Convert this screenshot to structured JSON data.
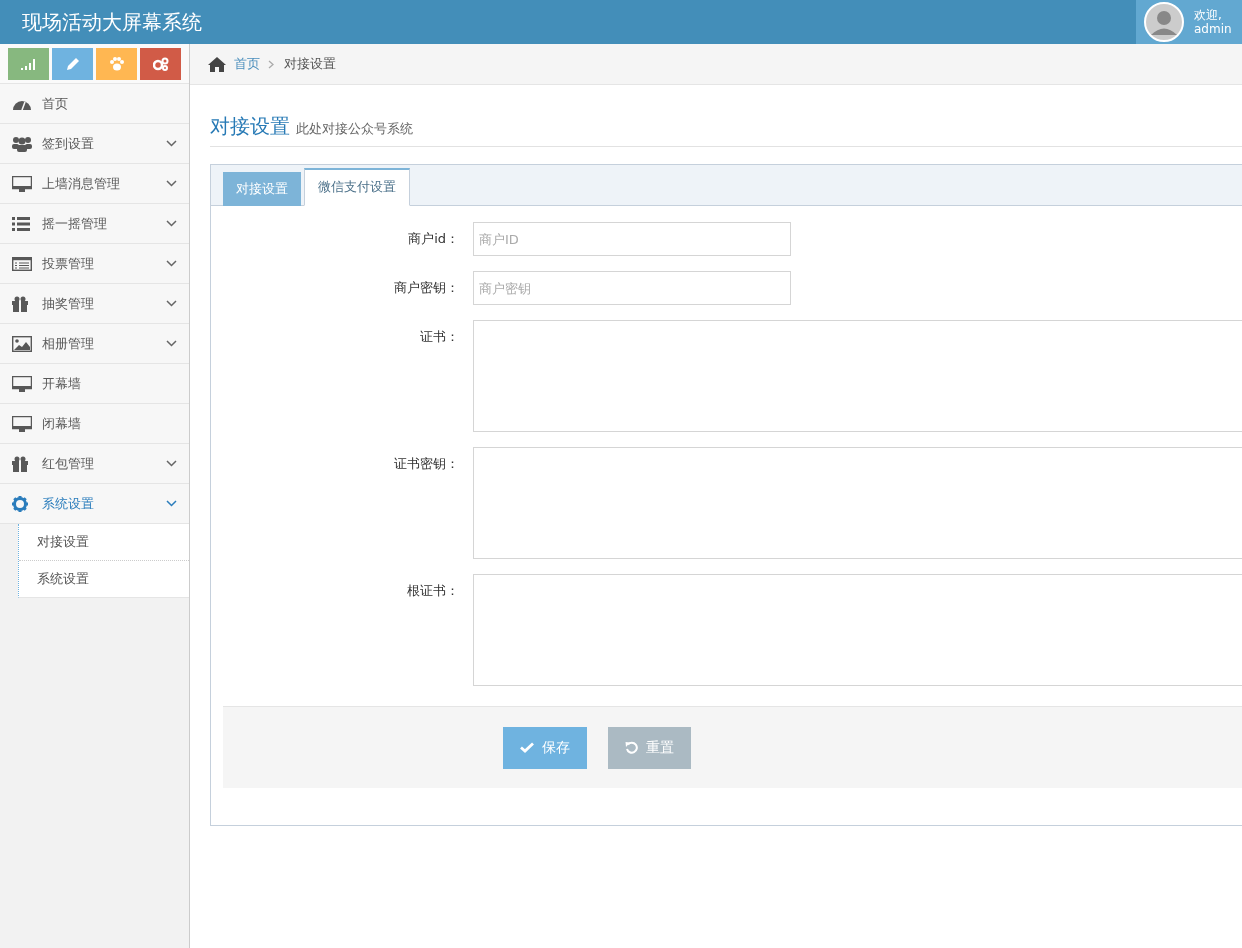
{
  "header": {
    "title": "现场活动大屏幕系统",
    "welcome": "欢迎,",
    "user": "admin"
  },
  "sidebar": {
    "shortcuts": [
      {
        "color": "#87b87f"
      },
      {
        "color": "#6fb3e0"
      },
      {
        "color": "#ffb752"
      },
      {
        "color": "#d15b47"
      }
    ],
    "items": [
      {
        "label": "首页",
        "has_submenu": false,
        "selected": false
      },
      {
        "label": "签到设置",
        "has_submenu": true,
        "selected": false
      },
      {
        "label": "上墙消息管理",
        "has_submenu": true,
        "selected": false
      },
      {
        "label": "摇一摇管理",
        "has_submenu": true,
        "selected": false
      },
      {
        "label": "投票管理",
        "has_submenu": true,
        "selected": false
      },
      {
        "label": "抽奖管理",
        "has_submenu": true,
        "selected": false
      },
      {
        "label": "相册管理",
        "has_submenu": true,
        "selected": false
      },
      {
        "label": "开幕墙",
        "has_submenu": false,
        "selected": false
      },
      {
        "label": "闭幕墙",
        "has_submenu": false,
        "selected": false
      },
      {
        "label": "红包管理",
        "has_submenu": true,
        "selected": false
      },
      {
        "label": "系统设置",
        "has_submenu": true,
        "selected": true,
        "children": [
          {
            "label": "对接设置"
          },
          {
            "label": "系统设置"
          }
        ]
      }
    ]
  },
  "breadcrumb": {
    "home": "首页",
    "current": "对接设置"
  },
  "page": {
    "title": "对接设置",
    "subtitle": "此处对接公众号系统"
  },
  "tabs": [
    {
      "label": "对接设置",
      "selected": false
    },
    {
      "label": "微信支付设置",
      "selected": true
    }
  ],
  "fields": [
    {
      "kind": "input",
      "label": "商户id：",
      "placeholder": "商户ID"
    },
    {
      "kind": "input",
      "label": "商户密钥：",
      "placeholder": "商户密钥"
    },
    {
      "kind": "textarea",
      "label": "证书："
    },
    {
      "kind": "textarea",
      "label": "证书密钥："
    },
    {
      "kind": "textarea",
      "label": "根证书："
    }
  ],
  "buttons": [
    {
      "kind": "save",
      "label": "保存"
    },
    {
      "kind": "reset",
      "label": "重置"
    }
  ]
}
